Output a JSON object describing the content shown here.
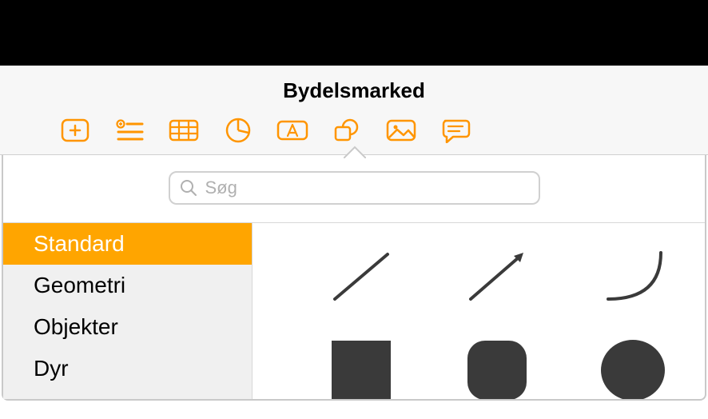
{
  "header": {
    "title": "Bydelsmarked"
  },
  "toolbar": {
    "items": [
      {
        "name": "add-icon"
      },
      {
        "name": "bullet-list-icon"
      },
      {
        "name": "table-icon"
      },
      {
        "name": "chart-icon"
      },
      {
        "name": "textbox-icon"
      },
      {
        "name": "shapes-icon"
      },
      {
        "name": "media-icon"
      },
      {
        "name": "comment-icon"
      }
    ]
  },
  "search": {
    "placeholder": "Søg"
  },
  "sidebar": {
    "items": [
      {
        "label": "Standard",
        "selected": true
      },
      {
        "label": "Geometri",
        "selected": false
      },
      {
        "label": "Objekter",
        "selected": false
      },
      {
        "label": "Dyr",
        "selected": false
      }
    ]
  },
  "shapes": {
    "row1": [
      "line",
      "arrow",
      "curve"
    ],
    "row2": [
      "square",
      "rounded-square",
      "circle"
    ]
  },
  "colors": {
    "accent": "#ff9500",
    "shape_fill": "#3a3a3a"
  }
}
